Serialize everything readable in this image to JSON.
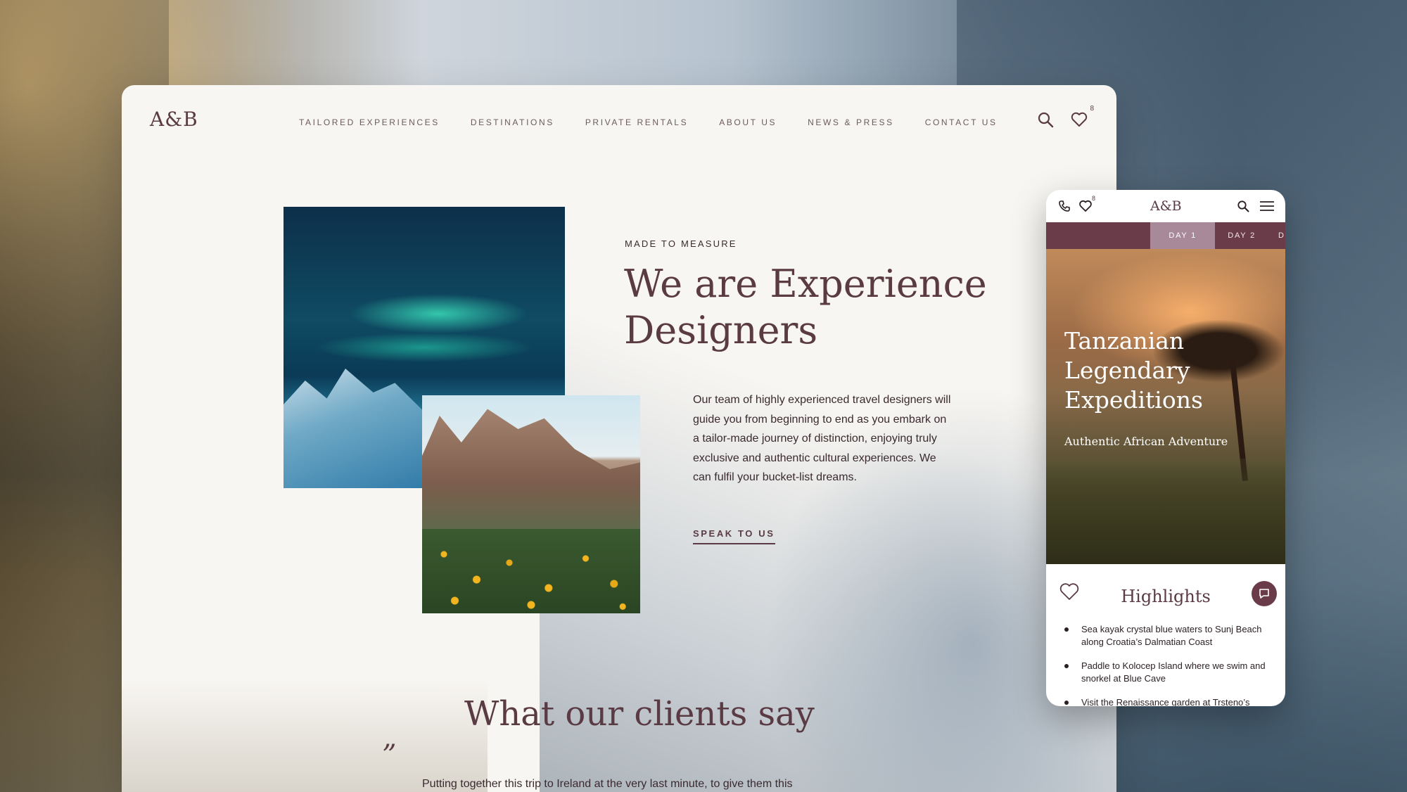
{
  "desktop": {
    "logo": "A&B",
    "nav": [
      "TAILORED EXPERIENCES",
      "DESTINATIONS",
      "PRIVATE RENTALS",
      "ABOUT US",
      "NEWS & PRESS",
      "CONTACT US"
    ],
    "wishlist_count": "8",
    "hero": {
      "eyebrow": "MADE TO MEASURE",
      "title": "We are Experience Designers",
      "body": "Our team of highly experienced travel designers will guide you from beginning to end as you embark on a tailor-made journey of distinction, enjoying truly exclusive and authentic cultural experiences. We can fulfil your bucket-list dreams.",
      "cta": "SPEAK TO US"
    },
    "testimonials": {
      "heading": "What our clients say",
      "quote_mark": "”",
      "quote": "Putting together this trip to Ireland at the very last minute, to give them this"
    }
  },
  "mobile": {
    "logo": "A&B",
    "wishlist_count": "8",
    "tabs": [
      "DAY 1",
      "DAY 2",
      "DAY"
    ],
    "hero": {
      "title": "Tanzanian Legendary Expeditions",
      "subtitle": "Authentic African Adventure"
    },
    "highlights": {
      "heading": "Highlights",
      "items": [
        "Sea kayak crystal blue waters to Sunj Beach along Croatia’s Dalmatian Coast",
        "Paddle to Kolocep Island where we swim and snorkel at Blue Cave",
        "Visit the Renaissance garden at Trsteno’s"
      ]
    }
  },
  "colors": {
    "brand": "#5a3a43",
    "tab_bar": "#6a3c4a",
    "tab_active": "#a8899a",
    "page_bg": "#f8f6f2"
  },
  "icons": [
    "search-icon",
    "heart-icon",
    "phone-icon",
    "menu-icon",
    "chat-icon"
  ]
}
